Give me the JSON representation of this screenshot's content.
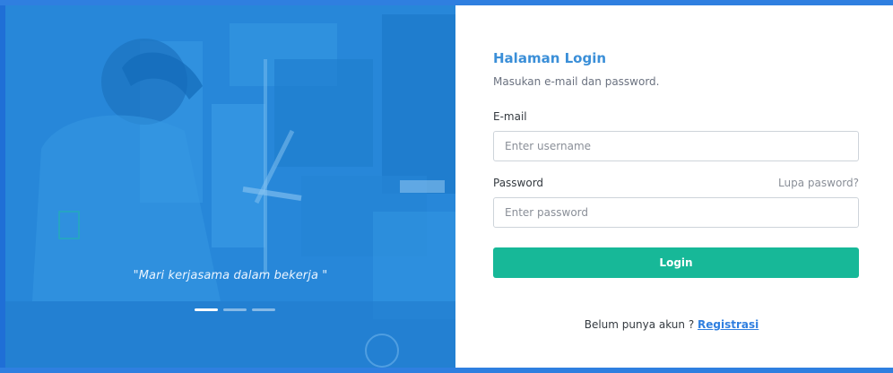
{
  "hero": {
    "quote": "\"Mari kerjasama dalam bekerja \"",
    "carousel": {
      "count": 3,
      "active_index": 0
    }
  },
  "form": {
    "title": "Halaman Login",
    "subtitle": "Masukan e-mail dan password.",
    "email": {
      "label": "E-mail",
      "placeholder": "Enter username",
      "value": ""
    },
    "password": {
      "label": "Password",
      "placeholder": "Enter password",
      "value": ""
    },
    "forgot_link": "Lupa pasword?",
    "login_button": "Login",
    "register": {
      "prompt": "Belum punya akun ? ",
      "link": "Registrasi"
    }
  },
  "colors": {
    "accent_blue": "#3b8fd8",
    "login_button": "#17b898",
    "hero_overlay": "#2f8fd8",
    "link": "#2f7fe0"
  }
}
